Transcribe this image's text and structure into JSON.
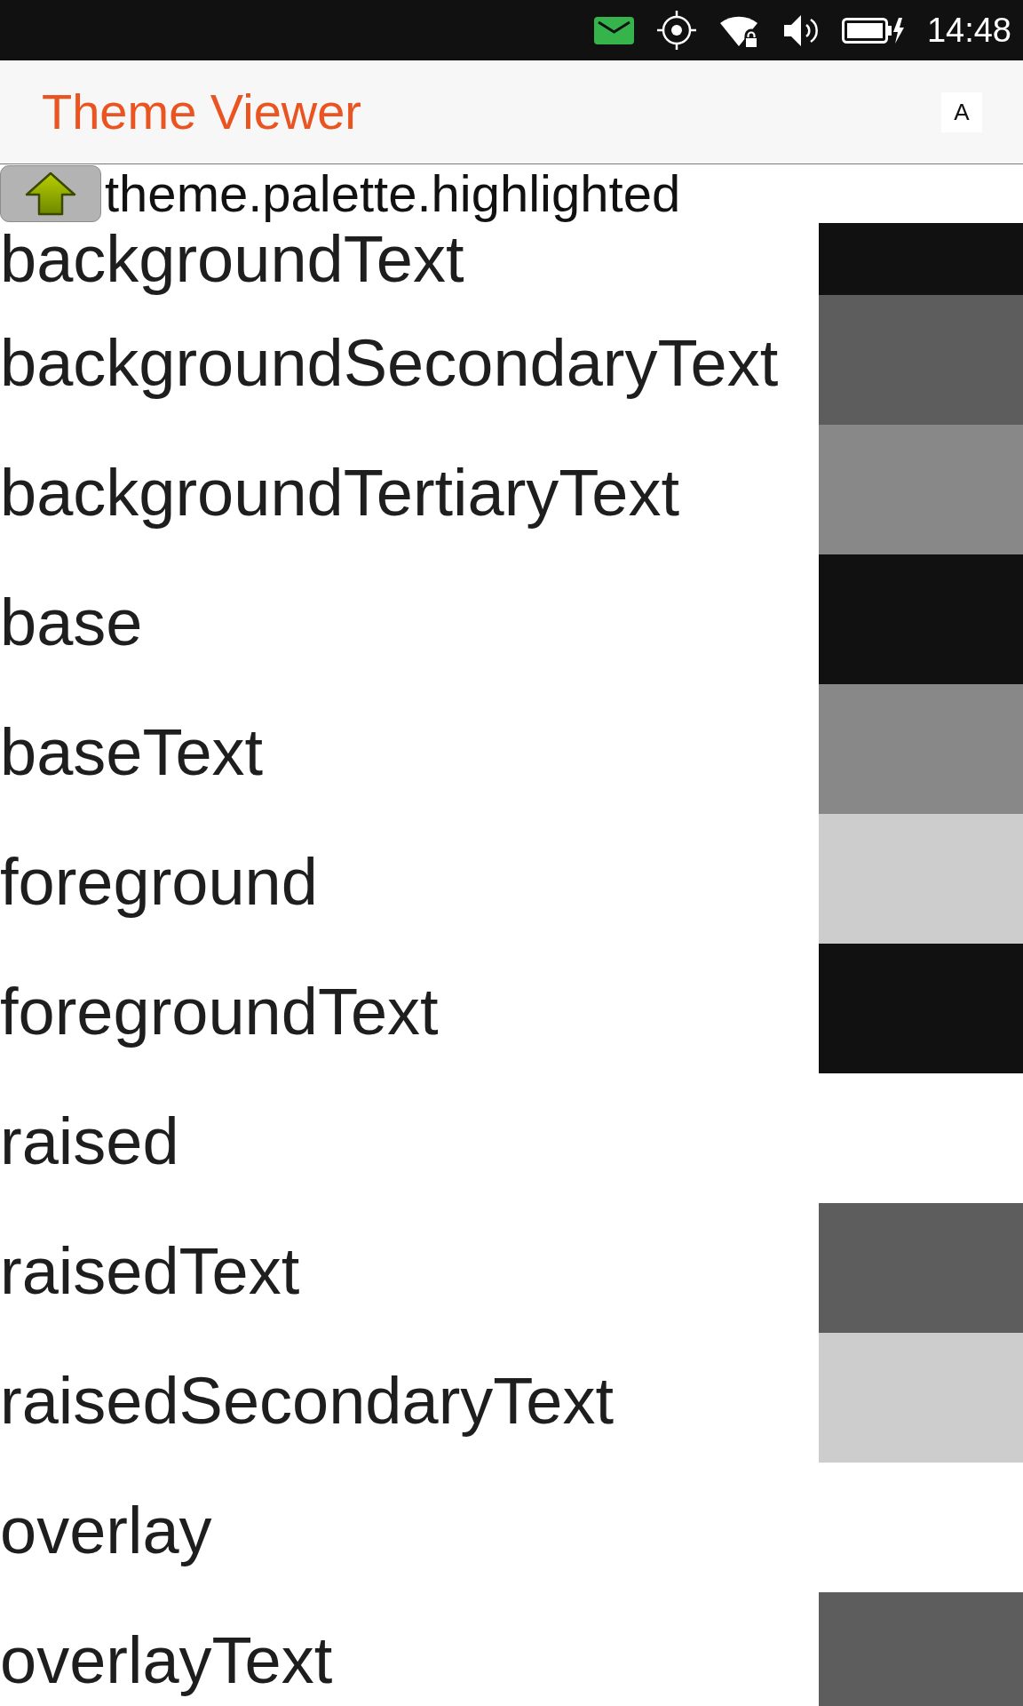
{
  "status_bar": {
    "time": "14:48"
  },
  "header": {
    "title": "Theme Viewer",
    "action": "A"
  },
  "path_bar": {
    "label": "theme.palette.highlighted"
  },
  "rows": [
    {
      "name": "backgroundText",
      "color": "#111111"
    },
    {
      "name": "backgroundSecondaryText",
      "color": "#5d5d5d"
    },
    {
      "name": "backgroundTertiaryText",
      "color": "#888888"
    },
    {
      "name": "base",
      "color": "#111111"
    },
    {
      "name": "baseText",
      "color": "#888888"
    },
    {
      "name": "foreground",
      "color": "#cdcdcd"
    },
    {
      "name": "foregroundText",
      "color": "#111111"
    },
    {
      "name": "raised"
    },
    {
      "name": "raisedText",
      "color": "#5d5d5d"
    },
    {
      "name": "raisedSecondaryText",
      "color": "#cdcdcd"
    },
    {
      "name": "overlay"
    },
    {
      "name": "overlayText",
      "color": "#5d5d5d"
    }
  ]
}
